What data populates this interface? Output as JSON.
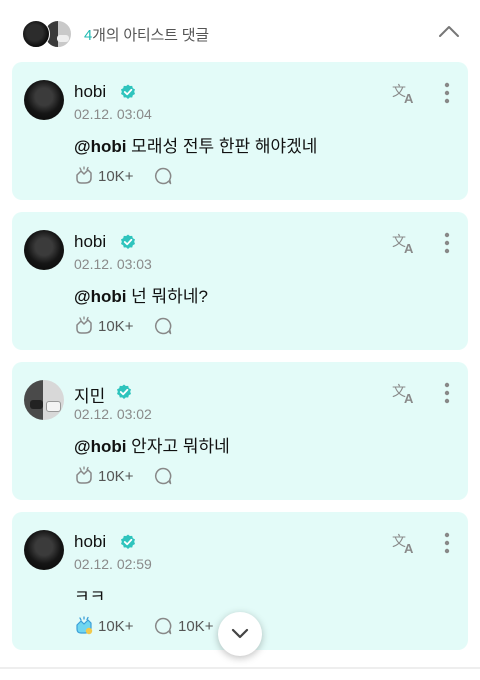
{
  "header": {
    "artist_count": "4",
    "artist_label": "개의 아티스트 댓글"
  },
  "colors": {
    "accent": "#1fbab2",
    "card_background": "#e3fbf8",
    "verified_badge": "#2ec4bd"
  },
  "comments": [
    {
      "author": "hobi",
      "time": "02.12. 03:04",
      "mention": "@hobi",
      "text": " 모래성 전투 한판 해야겠네",
      "likes": "10K+",
      "replies": "",
      "avatar": "dark",
      "liked": false
    },
    {
      "author": "hobi",
      "time": "02.12. 03:03",
      "mention": "@hobi",
      "text": " 넌 뭐하네?",
      "likes": "10K+",
      "replies": "",
      "avatar": "dark",
      "liked": false
    },
    {
      "author": "지민",
      "time": "02.12. 03:02",
      "mention": "@hobi",
      "text": " 안자고 뭐하네",
      "likes": "10K+",
      "replies": "",
      "avatar": "duo",
      "liked": false
    },
    {
      "author": "hobi",
      "time": "02.12. 02:59",
      "mention": "",
      "text": "ㅋㅋ",
      "likes": "10K+",
      "replies": "10K+",
      "avatar": "dark",
      "liked": true
    }
  ],
  "icons": {
    "collapse": "chevron-up-icon",
    "translate": "translate-icon",
    "more": "more-vertical-icon",
    "like": "cheer-icon",
    "comment": "comment-bubble-icon",
    "verified": "verified-badge-icon",
    "scroll": "chevron-down-icon"
  }
}
